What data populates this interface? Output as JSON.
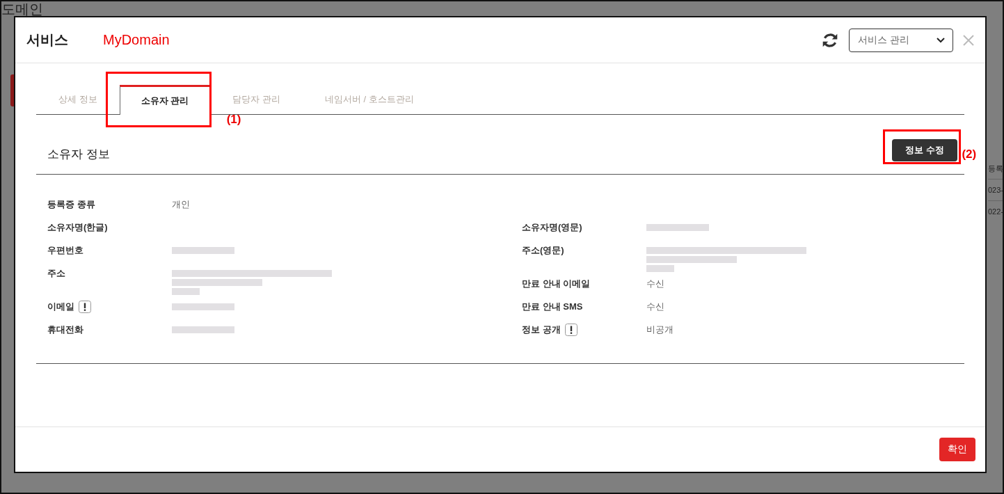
{
  "page_behind": {
    "title": "도메인",
    "table_header": "등록",
    "table_cells": [
      "023-",
      "022-"
    ]
  },
  "dialog": {
    "title": "서비스",
    "subtitle": "MyDomain",
    "menu_select": {
      "value": "서비스 관리"
    },
    "tabs": [
      {
        "label": "상세 정보",
        "selected": false
      },
      {
        "label": "소유자 관리",
        "selected": true,
        "annotation": "(1)"
      },
      {
        "label": "담당자 관리",
        "selected": false
      },
      {
        "label": "네임서버 / 호스트관리",
        "selected": false
      }
    ],
    "section": {
      "title": "소유자 정보",
      "edit_button": {
        "label": "정보 수정",
        "annotation": "(2)"
      }
    },
    "left_fields": [
      {
        "label": "등록증 종류",
        "kind": "text",
        "value": "개인",
        "notice": false
      },
      {
        "label": "소유자명(한글)",
        "kind": "empty",
        "notice": false
      },
      {
        "label": "우편번호",
        "kind": "redacted",
        "notice": false
      },
      {
        "label": "주소",
        "kind": "redacted_long",
        "notice": false
      },
      {
        "label": "이메일",
        "kind": "redacted",
        "notice": true
      },
      {
        "label": "휴대전화",
        "kind": "redacted",
        "notice": false
      }
    ],
    "right_fields": [
      {
        "label": "소유자명(영문)",
        "kind": "redacted",
        "notice": false
      },
      {
        "label": "주소(영문)",
        "kind": "redacted_long",
        "notice": false
      },
      {
        "label": "만료 안내 이메일",
        "kind": "text",
        "value": "수신",
        "notice": false
      },
      {
        "label": "만료 안내 SMS",
        "kind": "text",
        "value": "수신",
        "notice": false
      },
      {
        "label": "정보 공개",
        "kind": "text",
        "value": "비공개",
        "notice": true
      }
    ],
    "confirm_button": "확인"
  }
}
